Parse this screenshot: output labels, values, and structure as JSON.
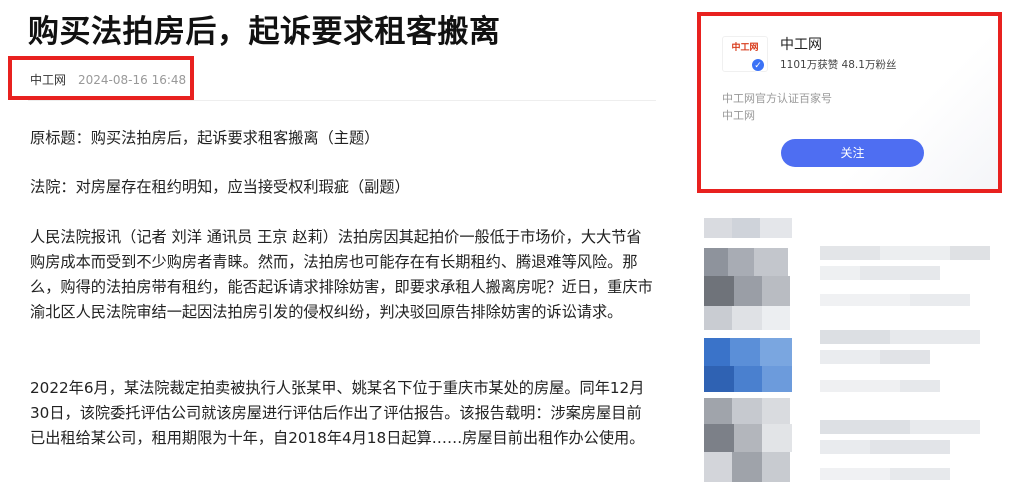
{
  "article": {
    "title": "购买法拍房后，起诉要求租客搬离",
    "source": "中工网",
    "datetime": "2024-08-16 16:48",
    "paragraphs": [
      "原标题：购买法拍房后，起诉要求租客搬离（主题）",
      "法院：对房屋存在租约明知，应当接受权利瑕疵（副题）",
      "人民法院报讯（记者 刘洋 通讯员 王京 赵莉）法拍房因其起拍价一般低于市场价，大大节省购房成本而受到不少购房者青睐。然而，法拍房也可能存在有长期租约、腾退难等风险。那么，购得的法拍房带有租约，能否起诉请求排除妨害，即要求承租人搬离房呢？近日，重庆市渝北区人民法院审结一起因法拍房引发的侵权纠纷，判决驳回原告排除妨害的诉讼请求。",
      "2022年6月，某法院裁定拍卖被执行人张某甲、姚某名下位于重庆市某处的房屋。同年12月30日，该院委托评估公司就该房屋进行评估后作出了评估报告。该报告载明：涉案房屋目前已出租给某公司，租用期限为十年，自2018年4月18日起算……房屋目前出租作办公使用。"
    ]
  },
  "author_card": {
    "logo_text": "中工网",
    "name": "中工网",
    "stats": "1101万获赞 48.1万粉丝",
    "desc_line1": "中工网官方认证百家号",
    "desc_line2": "中工网",
    "follow_label": "关注",
    "verify_icon": "✓"
  },
  "colors": {
    "highlight_border": "#e8211f",
    "follow_button": "#4e6ef2",
    "verify_badge": "#3b72f6"
  }
}
